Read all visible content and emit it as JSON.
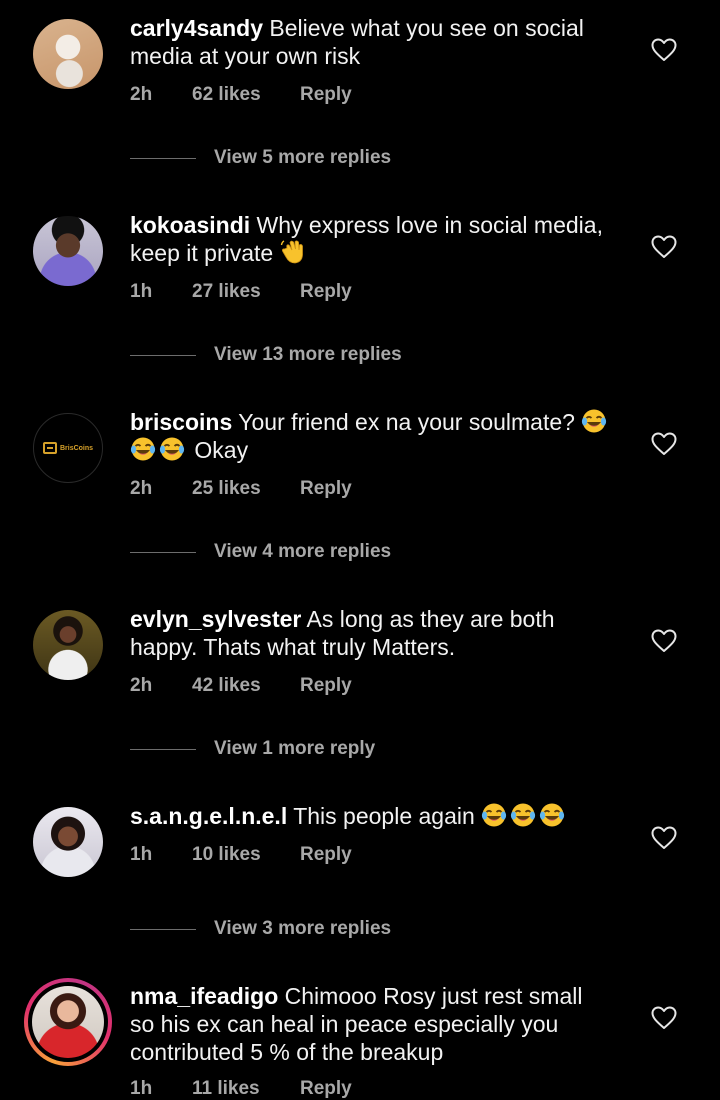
{
  "comments": [
    {
      "username": "carly4sandy",
      "text": "Believe what you see on social media at your own risk",
      "time": "2h",
      "likes": "62 likes",
      "reply": "Reply",
      "view_replies": "View 5 more replies",
      "avatar": "avatar-carly4sandy"
    },
    {
      "username": "kokoasindi",
      "text": "Why express love in social media, keep it private",
      "emoji": "waving-hand",
      "time": "1h",
      "likes": "27 likes",
      "reply": "Reply",
      "view_replies": "View 13 more replies",
      "avatar": "avatar-kokoasindi"
    },
    {
      "username": "briscoins",
      "text_before": "Your friend ex na your soulmate?",
      "text_after": "Okay",
      "emoji": "tears-of-joy",
      "time": "2h",
      "likes": "25 likes",
      "reply": "Reply",
      "view_replies": "View 4 more replies",
      "avatar_text": "BrisCoins"
    },
    {
      "username": "evlyn_sylvester",
      "text": "As long as they are both happy. Thats what truly Matters.",
      "time": "2h",
      "likes": "42 likes",
      "reply": "Reply",
      "view_replies": "View 1 more reply",
      "avatar": "avatar-evlyn"
    },
    {
      "username": "s.a.n.g.e.l.n.e.l",
      "text": "This people again",
      "emoji": "tears-of-joy",
      "time": "1h",
      "likes": "10 likes",
      "reply": "Reply",
      "view_replies": "View 3 more replies",
      "avatar": "avatar-sangelnel"
    },
    {
      "username": "nma_ifeadigo",
      "text": "Chimooo Rosy just rest small so his ex can heal in peace especially you contributed 5 % of the breakup",
      "time": "1h",
      "likes": "11 likes",
      "reply": "Reply",
      "avatar": "avatar-nma-ifeadigo",
      "has_story": true
    }
  ],
  "icons": {
    "like": "heart-outline-icon"
  },
  "colors": {
    "background": "#000000",
    "primary_text": "#f2f2f2",
    "secondary_text": "#a8a8a8",
    "story_ring": "#e1306c"
  }
}
